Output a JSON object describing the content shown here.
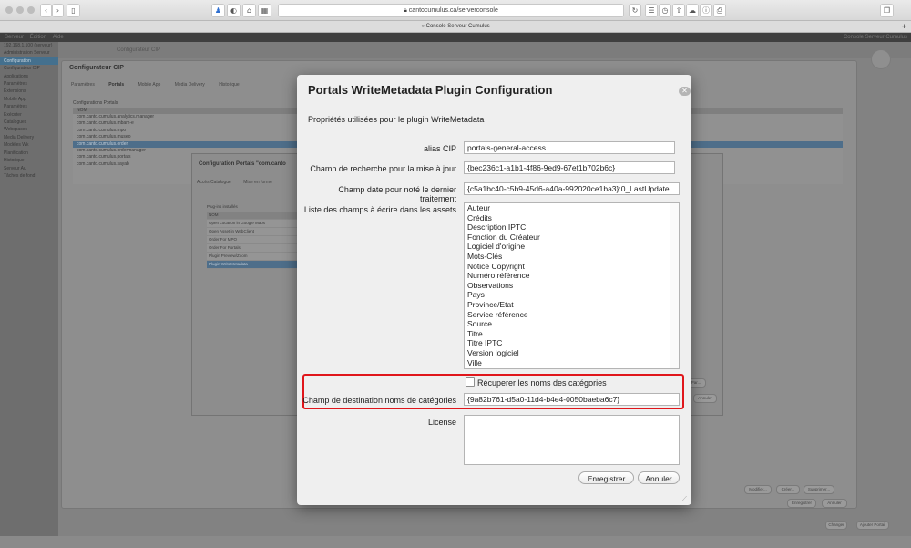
{
  "browser": {
    "url": "cantocumulus.ca/serverconsole",
    "tab_title": "Console Serveur Cumulus"
  },
  "app": {
    "menu": [
      "Serveur",
      "Édition",
      "Aide"
    ],
    "menu_right": "Console Serveur Cumulus",
    "tree_items": [
      "192.168.1.100 (serveur)",
      "Administration Serveur",
      "Configuration",
      "Configurateur CIP",
      "Applications",
      "Paramètres",
      "Extensions",
      "Mobile App",
      "Paramètres",
      "Exécuter",
      "Catalogues",
      "Webspaces",
      "Media Delivery",
      "Modèles Wk",
      "Planification",
      "Historique",
      "Serveur Au",
      "Tâches de fond"
    ],
    "tree_selected_index": 2
  },
  "cip": {
    "breadcrumb": "Configurateur CIP",
    "title": "Configurateur CIP",
    "tabs": [
      "Paramètres",
      "Portals",
      "Mobile App",
      "Media Delivery",
      "Historique"
    ],
    "active_tab": 1,
    "list_label": "Configurations Portals",
    "list_header": "NOM",
    "rows": [
      "com.canto.cumulus.analytics.manager",
      "com.canto.cumulus.mbam-e",
      "com.canto.cumulus.mpo",
      "com.canto.cumulus.museo",
      "com.canto.cumulus.order",
      "com.canto.cumulus.ordermanager",
      "com.canto.cumulus.portals",
      "com.canto.cumulus.sayab"
    ],
    "selected_row": 4,
    "buttons": [
      "Modifier...",
      "Créer...",
      "Supprimer..."
    ],
    "save_buttons": [
      "Enregistrer",
      "Annuler"
    ],
    "footer_buttons": [
      "Changer",
      "Ajouter Portail"
    ]
  },
  "portal_config": {
    "title": "Configuration Portals \"com.canto",
    "tabs": [
      "Accès Catalogue",
      "Mise en forme"
    ],
    "plugins_label": "Plug-ins installés",
    "plugins_header": "NOM",
    "plugins": [
      "Open Location in Google Maps",
      "Open Asset in WebClient",
      "Order For MPO",
      "Order For Portals",
      "Plugin Preview/Zoom",
      "Plugin WriteMetadata"
    ],
    "selected_plugin": 5,
    "btn_partial": "Par...",
    "btn_cancel": "Annuler"
  },
  "dialog": {
    "title": "Portals WriteMetadata Plugin Configuration",
    "subtitle": "Propriétés utilisées pour le plugin WriteMetadata",
    "alias_label": "alias CIP",
    "alias_value": "portals-general-access",
    "search_label": "Champ de recherche pour la mise à jour",
    "search_value": "{bec236c1-a1b1-4f86-9ed9-67ef1b702b6c}",
    "date_label": "Champ date pour noté le dernier traitement",
    "date_value": "{c5a1bc40-c5b9-45d6-a40a-992020ce1ba3}:0_LastUpdate",
    "fields_label": "Liste des champs à écrire dans les assets",
    "fields": [
      "Auteur",
      "Crédits",
      "Description IPTC",
      "Fonction du Créateur",
      "Logiciel d'origine",
      "Mots-Clés",
      "Notice Copyright",
      "Numéro référence",
      "Observations",
      "Pays",
      "Province/Etat",
      "Service référence",
      "Source",
      "Titre",
      "Titre IPTC",
      "Version logiciel",
      "Ville"
    ],
    "recover_label": "Récuperer les noms des catégories",
    "recover_checked": false,
    "dest_label": "Champ de destination noms de catégories",
    "dest_value": "{9a82b761-d5a0-11d4-b4e4-0050baeba6c7}",
    "license_label": "License",
    "license_value": "",
    "save_label": "Enregistrer",
    "cancel_label": "Annuler",
    "highlight_color": "#e0161b"
  }
}
